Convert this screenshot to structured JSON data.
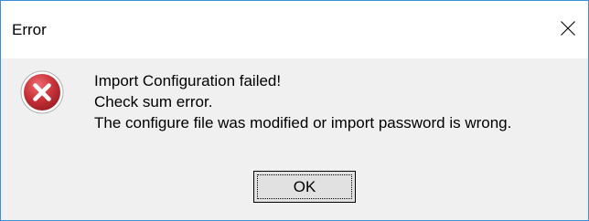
{
  "window": {
    "title": "Error",
    "close_icon": "close-icon"
  },
  "dialog": {
    "icon": "error-icon",
    "icon_color": "#c83238",
    "lines": [
      "Import Configuration failed!",
      "Check sum error.",
      "The configure file was modified or import password is wrong."
    ],
    "ok_label": "OK"
  },
  "colors": {
    "window_border": "#3c8ed6",
    "body_background": "#f0f0f0",
    "button_background": "#e1e1e1"
  }
}
